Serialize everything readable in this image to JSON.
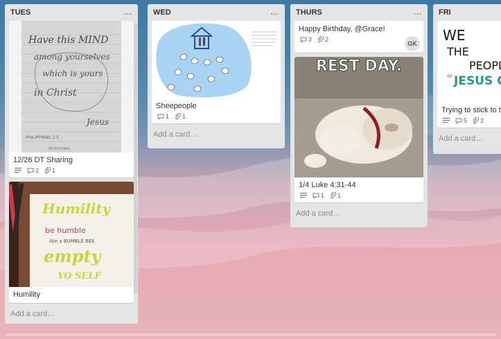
{
  "board": {
    "lists": [
      {
        "name": "TUES",
        "menu": "...",
        "cards": [
          {
            "title": "12/26 DT Sharing",
            "comments": "2",
            "attachments": "1",
            "cover": {
              "line1": "Have this MIND",
              "line2": "among yourselves",
              "line3": "which is yours",
              "line4": "in Christ",
              "line5": "Jesus",
              "ref": "PHILIPPIANS 2:5",
              "footer": "DEVOTIONAL"
            }
          },
          {
            "title": "Humility",
            "cover": {
              "line1": "Humility",
              "line2": "be humble",
              "line3": "like a BUMBLE BEE",
              "line4": "empty",
              "line5": "YO SELF"
            }
          }
        ],
        "add_card": "Add a card…"
      },
      {
        "name": "WED",
        "menu": "...",
        "cards": [
          {
            "title": "Sheepeople",
            "comments": "1",
            "attachments": "1"
          }
        ],
        "add_card": "Add a card…"
      },
      {
        "name": "THURS",
        "menu": "...",
        "cards": [
          {
            "title": "Happy Birthday, @Grace!",
            "comments": "3",
            "attachments": "2",
            "avatar": "GK"
          },
          {
            "title": "1/4 Luke 4:31-44",
            "comments": "1",
            "attachments": "1",
            "cover_text": "REST DAY."
          }
        ],
        "add_card": "Add a card…"
      },
      {
        "name": "FRI",
        "menu": "...",
        "cards": [
          {
            "title": "Trying to stick to th",
            "comments": "5",
            "attachments": "2",
            "cover": {
              "line1": "WE",
              "line2": "THE",
              "line3": "PEOPL",
              "line4": "OF",
              "line5": "JESUS C"
            }
          }
        ],
        "add_card": "Add a card…"
      }
    ]
  }
}
